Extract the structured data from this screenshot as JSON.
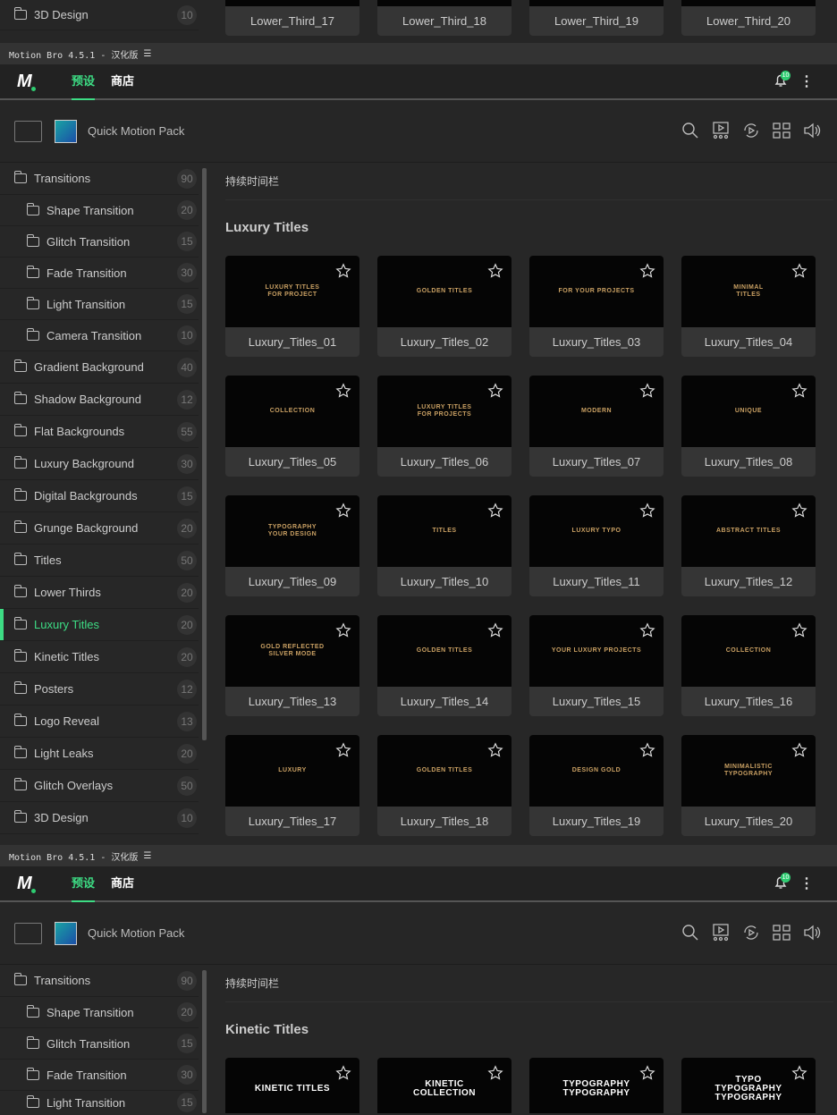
{
  "fragment": {
    "sidebar": [
      {
        "label": "3D Design",
        "count": "10"
      }
    ],
    "cards": [
      "Lower_Third_17",
      "Lower_Third_18",
      "Lower_Third_19",
      "Lower_Third_20"
    ]
  },
  "panels": [
    {
      "titlebar": "Motion Bro 4.5.1 - 汉化版",
      "tabs": [
        "预设",
        "商店"
      ],
      "notification_count": "10",
      "pack_name": "Quick Motion Pack",
      "duration_label": "持续时间栏",
      "section_title": "Luxury Titles",
      "active": "Luxury Titles",
      "sidebar": [
        {
          "label": "Transitions",
          "count": "90"
        },
        {
          "label": "Shape Transition",
          "count": "20",
          "sub": true
        },
        {
          "label": "Glitch Transition",
          "count": "15",
          "sub": true
        },
        {
          "label": "Fade Transition",
          "count": "30",
          "sub": true
        },
        {
          "label": "Light Transition",
          "count": "15",
          "sub": true
        },
        {
          "label": "Camera Transition",
          "count": "10",
          "sub": true
        },
        {
          "label": "Gradient Background",
          "count": "40"
        },
        {
          "label": "Shadow Background",
          "count": "12"
        },
        {
          "label": "Flat Backgrounds",
          "count": "55"
        },
        {
          "label": "Luxury Background",
          "count": "30"
        },
        {
          "label": "Digital Backgrounds",
          "count": "15"
        },
        {
          "label": "Grunge Background",
          "count": "20"
        },
        {
          "label": "Titles",
          "count": "50"
        },
        {
          "label": "Lower Thirds",
          "count": "20"
        },
        {
          "label": "Luxury Titles",
          "count": "20"
        },
        {
          "label": "Kinetic Titles",
          "count": "20"
        },
        {
          "label": "Posters",
          "count": "12"
        },
        {
          "label": "Logo Reveal",
          "count": "13"
        },
        {
          "label": "Light Leaks",
          "count": "20"
        },
        {
          "label": "Glitch Overlays",
          "count": "50"
        },
        {
          "label": "3D Design",
          "count": "10"
        }
      ],
      "cards": [
        {
          "name": "Luxury_Titles_01",
          "thumb": "LUXURY TITLES\nFOR PROJECT"
        },
        {
          "name": "Luxury_Titles_02",
          "thumb": "GOLDEN TITLES"
        },
        {
          "name": "Luxury_Titles_03",
          "thumb": "FOR YOUR PROJECTS"
        },
        {
          "name": "Luxury_Titles_04",
          "thumb": "MINIMAL\nTITLES"
        },
        {
          "name": "Luxury_Titles_05",
          "thumb": "COLLECTION"
        },
        {
          "name": "Luxury_Titles_06",
          "thumb": "LUXURY TITLES\nFOR PROJECTS"
        },
        {
          "name": "Luxury_Titles_07",
          "thumb": "MODERN"
        },
        {
          "name": "Luxury_Titles_08",
          "thumb": "UNIQUE"
        },
        {
          "name": "Luxury_Titles_09",
          "thumb": "TYPOGRAPHY\nYOUR DESIGN"
        },
        {
          "name": "Luxury_Titles_10",
          "thumb": "TITLES"
        },
        {
          "name": "Luxury_Titles_11",
          "thumb": "LUXURY TYPO"
        },
        {
          "name": "Luxury_Titles_12",
          "thumb": "ABSTRACT TITLES"
        },
        {
          "name": "Luxury_Titles_13",
          "thumb": "GOLD REFLECTED\nSILVER MODE"
        },
        {
          "name": "Luxury_Titles_14",
          "thumb": "GOLDEN TITLES"
        },
        {
          "name": "Luxury_Titles_15",
          "thumb": "YOUR LUXURY PROJECTS"
        },
        {
          "name": "Luxury_Titles_16",
          "thumb": "COLLECTION"
        },
        {
          "name": "Luxury_Titles_17",
          "thumb": "LUXURY"
        },
        {
          "name": "Luxury_Titles_18",
          "thumb": "GOLDEN TITLES"
        },
        {
          "name": "Luxury_Titles_19",
          "thumb": "DESIGN GOLD"
        },
        {
          "name": "Luxury_Titles_20",
          "thumb": "MINIMALISTIC\nTYPOGRAPHY"
        }
      ]
    },
    {
      "titlebar": "Motion Bro 4.5.1 - 汉化版",
      "tabs": [
        "预设",
        "商店"
      ],
      "notification_count": "10",
      "pack_name": "Quick Motion Pack",
      "duration_label": "持续时间栏",
      "section_title": "Kinetic Titles",
      "active": "",
      "sidebar": [
        {
          "label": "Transitions",
          "count": "90"
        },
        {
          "label": "Shape Transition",
          "count": "20",
          "sub": true
        },
        {
          "label": "Glitch Transition",
          "count": "15",
          "sub": true
        },
        {
          "label": "Fade Transition",
          "count": "30",
          "sub": true
        },
        {
          "label": "Light Transition",
          "count": "15",
          "sub": true
        }
      ],
      "cards": [
        {
          "name": "",
          "thumb": "KINETIC TITLES",
          "teal": true
        },
        {
          "name": "",
          "thumb": "KINETIC\nCOLLECTION",
          "teal": true
        },
        {
          "name": "",
          "thumb": "TYPOGRAPHY\nTYPOGRAPHY",
          "teal": true
        },
        {
          "name": "",
          "thumb": "TYPO\nTYPOGRAPHY\nTYPOGRAPHY",
          "teal": true
        }
      ]
    }
  ],
  "colors": {
    "accent": "#3ddc84",
    "thumb_gold": "#c9a063"
  }
}
